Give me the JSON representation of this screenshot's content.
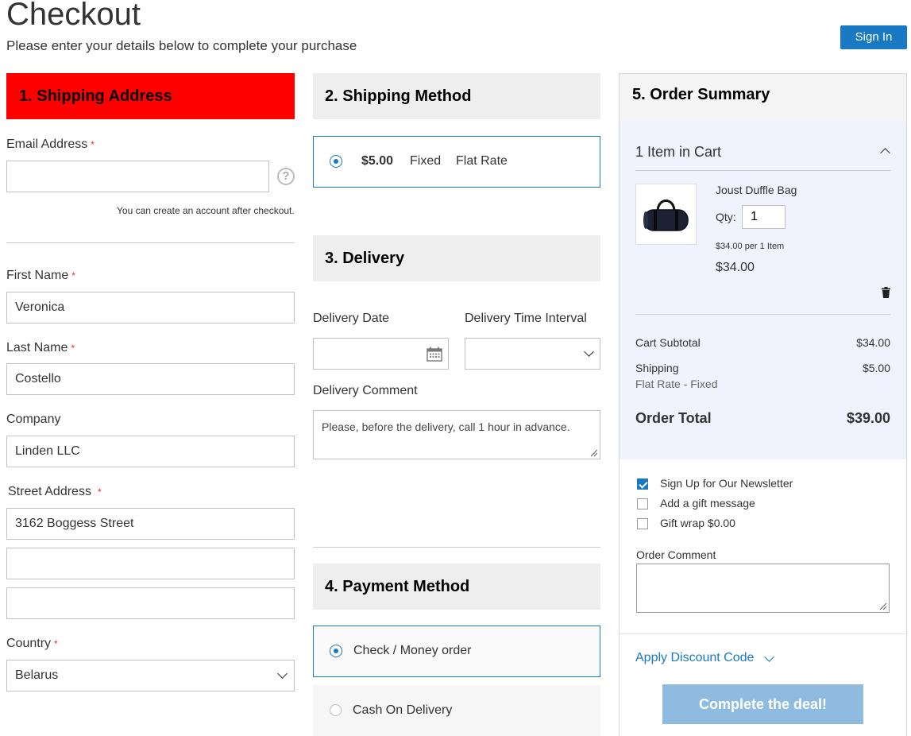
{
  "header": {
    "title": "Checkout",
    "subtitle": "Please enter your details below to complete your purchase",
    "signin_label": "Sign In"
  },
  "shipping_address": {
    "heading": "1. Shipping Address",
    "email_label": "Email Address",
    "email_value": "",
    "account_note": "You can create an account after checkout.",
    "first_name_label": "First Name",
    "first_name_value": "Veronica",
    "last_name_label": "Last Name",
    "last_name_value": "Costello",
    "company_label": "Company",
    "company_value": "Linden LLC",
    "street_label": "Street Address",
    "street_line1": "3162 Boggess Street",
    "street_line2": "",
    "street_line3": "",
    "country_label": "Country",
    "country_value": "Belarus",
    "required_mark": "*",
    "help_glyph": "?"
  },
  "shipping_method": {
    "heading": "2. Shipping Method",
    "option": {
      "price": "$5.00",
      "method": "Fixed",
      "carrier": "Flat Rate",
      "selected": true
    }
  },
  "delivery": {
    "heading": "3. Delivery",
    "date_label": "Delivery Date",
    "date_value": "",
    "time_label": "Delivery Time Interval",
    "time_value": "",
    "comment_label": "Delivery Comment",
    "comment_value": "Please, before the delivery, call 1 hour in advance."
  },
  "payment_method": {
    "heading": "4. Payment Method",
    "options": [
      {
        "label": "Check / Money order",
        "selected": true
      },
      {
        "label": "Cash On Delivery",
        "selected": false
      }
    ]
  },
  "order_summary": {
    "heading": "5. Order Summary",
    "cart_count_label": "1 Item in Cart",
    "item": {
      "name": "Joust Duffle Bag",
      "qty_label": "Qty:",
      "qty_value": "1",
      "unit_price_note": "$34.00 per 1 Item",
      "price": "$34.00"
    },
    "subtotal_label": "Cart Subtotal",
    "subtotal_value": "$34.00",
    "shipping_label": "Shipping",
    "shipping_value": "$5.00",
    "shipping_method": "Flat Rate - Fixed",
    "total_label": "Order Total",
    "total_value": "$39.00",
    "options": [
      {
        "label": "Sign Up for Our Newsletter",
        "checked": true
      },
      {
        "label": "Add a gift message",
        "checked": false
      },
      {
        "label": "Gift wrap $0.00",
        "checked": false
      }
    ],
    "comment_label": "Order Comment",
    "comment_value": "",
    "discount_label": "Apply Discount Code",
    "submit_label": "Complete the deal!"
  },
  "colors": {
    "accent": "#1979c3",
    "shipping_header": "#ff0000",
    "section_header": "#eeeeee",
    "summary_panel": "#f0f3fe",
    "submit_button": "#8fbbe0",
    "required": "#e02b27"
  },
  "icons": [
    "help-icon",
    "calendar-icon",
    "chevron-down-icon",
    "chevron-up-icon",
    "trash-icon",
    "resize-grip-icon",
    "product-thumbnail"
  ]
}
